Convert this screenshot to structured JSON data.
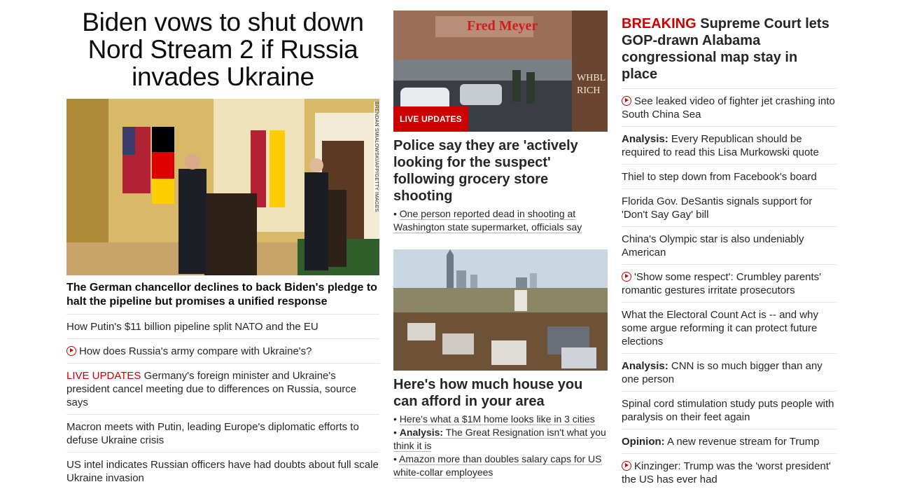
{
  "col1": {
    "headline": "Biden vows to shut down Nord Stream 2 if Russia invades Ukraine",
    "photo_credit": "BRENDAN SMIALOWSKI/AFP/GETTY IMAGES",
    "lead_sub": "The German chancellor declines to back Biden's pledge to halt the pipeline but promises a unified response",
    "items": [
      {
        "text": "How Putin's $11 billion pipeline split NATO and the EU"
      },
      {
        "video": true,
        "text": "How does Russia's army compare with Ukraine's?"
      },
      {
        "tag": "LIVE UPDATES",
        "text": " Germany's foreign minister and Ukraine's president cancel meeting due to differences on Russia, source says"
      },
      {
        "text": "Macron meets with Putin, leading Europe's diplomatic efforts to defuse Ukraine crisis"
      },
      {
        "text": "US intel indicates Russian officers have had doubts about full scale Ukraine invasion"
      }
    ]
  },
  "col2": {
    "badge": "LIVE UPDATES",
    "story1_headline": "Police say they are 'actively looking for the suspect' following grocery store shooting",
    "story1_sub": "One person reported dead in shooting at Washington state supermarket, officials say",
    "story2_headline": "Here's how much house you can afford in your area",
    "story2_subs": [
      {
        "prefix": "",
        "text": "Here's what a $1M home looks like in 3 cities"
      },
      {
        "prefix": "Analysis:",
        "text": " The Great Resignation isn't what you think it is"
      },
      {
        "prefix": "",
        "text": "Amazon more than doubles salary caps for US white-collar employees"
      }
    ]
  },
  "col3": {
    "breaking_tag": "BREAKING",
    "breaking_text": " Supreme Court lets GOP-drawn Alabama congressional map stay in place",
    "items": [
      {
        "video": true,
        "prefix": "",
        "text": "See leaked video of fighter jet crashing into South China Sea"
      },
      {
        "video": false,
        "prefix": "Analysis:",
        "text": " Every Republican should be required to read this Lisa Murkowski quote"
      },
      {
        "video": false,
        "prefix": "",
        "text": "Thiel to step down from Facebook's board"
      },
      {
        "video": false,
        "prefix": "",
        "text": "Florida Gov. DeSantis signals support for 'Don't Say Gay' bill"
      },
      {
        "video": false,
        "prefix": "",
        "text": "China's Olympic star is also undeniably American"
      },
      {
        "video": true,
        "prefix": "",
        "text": "'Show some respect': Crumbley parents' romantic gestures irritate prosecutors"
      },
      {
        "video": false,
        "prefix": "",
        "text": "What the Electoral Count Act is -- and why some argue reforming it can protect future elections"
      },
      {
        "video": false,
        "prefix": "Analysis:",
        "text": " CNN is so much bigger than any one person"
      },
      {
        "video": false,
        "prefix": "",
        "text": "Spinal cord stimulation study puts people with paralysis on their feet again"
      },
      {
        "video": false,
        "prefix": "Opinion:",
        "text": " A new revenue stream for Trump"
      },
      {
        "video": true,
        "prefix": "",
        "text": "Kinzinger: Trump was the 'worst president' the US has ever had"
      }
    ]
  },
  "colors": {
    "accent_red": "#cc0000",
    "text": "#262626",
    "divider": "#e6e6e6"
  }
}
